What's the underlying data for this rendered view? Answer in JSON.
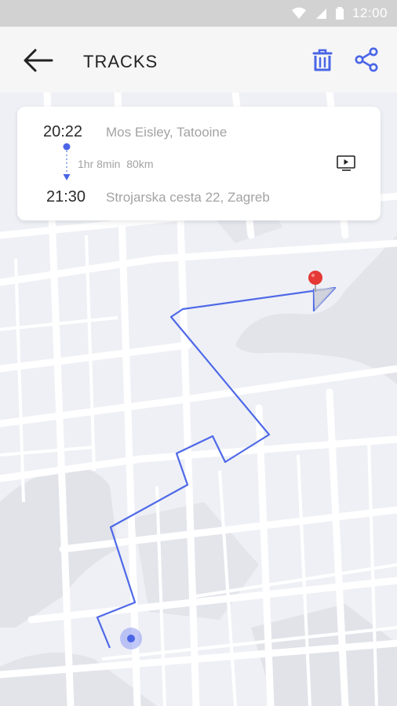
{
  "status": {
    "time": "12:00"
  },
  "appbar": {
    "title": "TRACKS"
  },
  "trip": {
    "start_time": "20:22",
    "start_place": "Mos Eisley, Tatooine",
    "duration": "1hr 8min",
    "distance": "80km",
    "end_time": "21:30",
    "end_place": "Strojarska cesta 22, Zagreb"
  },
  "colors": {
    "accent": "#4a65e6",
    "pin": "#e53935",
    "route": "#4f69e8"
  },
  "icons": {
    "back": "arrow-left-icon",
    "delete": "trash-icon",
    "share": "share-icon",
    "playback": "playback-icon"
  }
}
